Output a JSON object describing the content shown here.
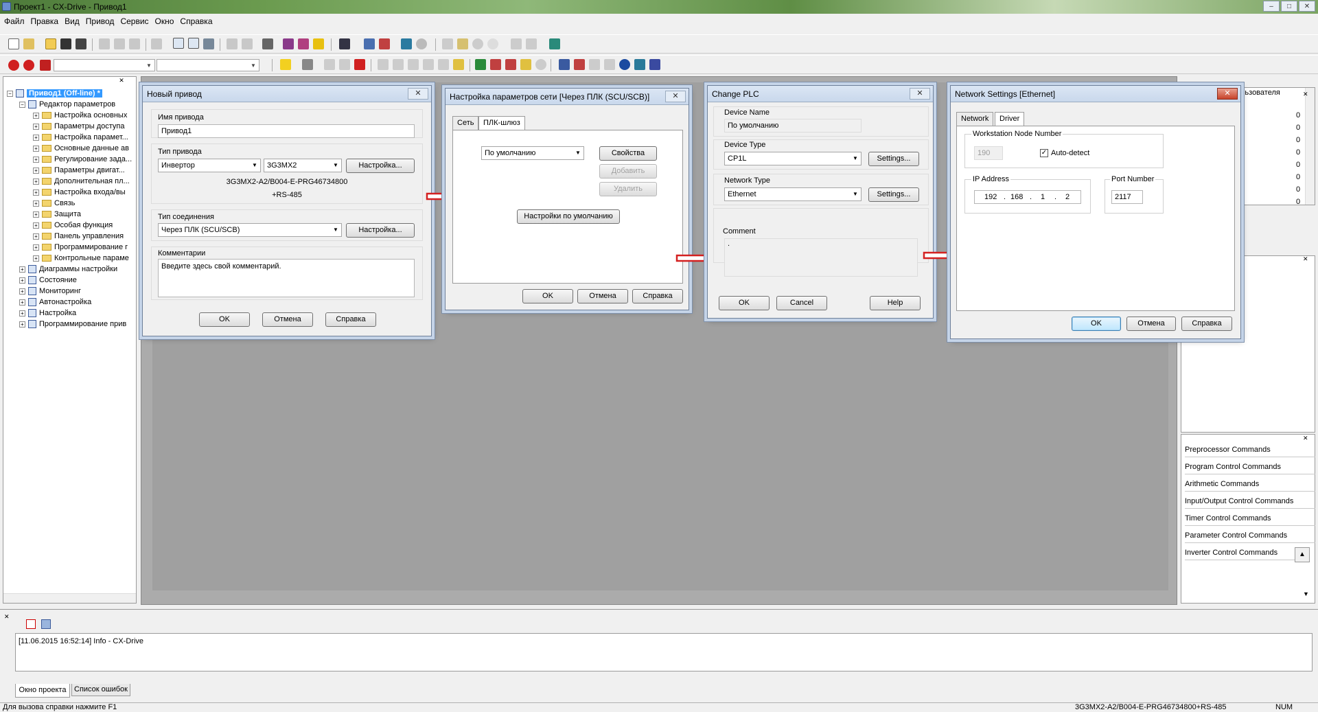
{
  "window": {
    "title": "Проект1 - CX-Drive - Привод1"
  },
  "menu": [
    "Файл",
    "Правка",
    "Вид",
    "Привод",
    "Сервис",
    "Окно",
    "Справка"
  ],
  "tree": {
    "root": "Привод1 (Off-line) *",
    "items": [
      {
        "label": "Редактор параметров",
        "level": 1,
        "icon": "doc"
      },
      {
        "label": "Настройка основных",
        "level": 2,
        "icon": "folder"
      },
      {
        "label": "Параметры доступа",
        "level": 2,
        "icon": "folder"
      },
      {
        "label": "Настройка парамет...",
        "level": 2,
        "icon": "folder"
      },
      {
        "label": "Основные данные ав",
        "level": 2,
        "icon": "folder"
      },
      {
        "label": "Регулирование зада...",
        "level": 2,
        "icon": "folder"
      },
      {
        "label": "Параметры двигат...",
        "level": 2,
        "icon": "folder"
      },
      {
        "label": "Дополнительная пл...",
        "level": 2,
        "icon": "folder"
      },
      {
        "label": "Настройка входа/вы",
        "level": 2,
        "icon": "folder"
      },
      {
        "label": "Связь",
        "level": 2,
        "icon": "folder"
      },
      {
        "label": "Защита",
        "level": 2,
        "icon": "folder"
      },
      {
        "label": "Особая функция",
        "level": 2,
        "icon": "folder"
      },
      {
        "label": "Панель управления",
        "level": 2,
        "icon": "folder"
      },
      {
        "label": "Программирование г",
        "level": 2,
        "icon": "folder"
      },
      {
        "label": "Контрольные параме",
        "level": 2,
        "icon": "folder"
      },
      {
        "label": "Диаграммы настройки",
        "level": 1,
        "icon": "doc"
      },
      {
        "label": "Состояние",
        "level": 1,
        "icon": "doc"
      },
      {
        "label": "Мониторинг",
        "level": 1,
        "icon": "doc"
      },
      {
        "label": "Автонастройка",
        "level": 1,
        "icon": "doc"
      },
      {
        "label": "Настройка",
        "level": 1,
        "icon": "doc"
      },
      {
        "label": "Программирование прив",
        "level": 1,
        "icon": "doc"
      }
    ]
  },
  "dlg1": {
    "title": "Новый привод",
    "name_label": "Имя привода",
    "name_value": "Привод1",
    "type_label": "Тип привода",
    "type_value": "Инвертор",
    "model_value": "3G3MX2",
    "settings_btn": "Настройка...",
    "model_full": "3G3MX2-A2/B004-E-PRG46734800",
    "model_option": "+RS-485",
    "conn_label": "Тип соединения",
    "conn_value": "Через ПЛК (SCU/SCB)",
    "settings_btn2": "Настройка...",
    "comment_label": "Комментарии",
    "comment_value": "Введите здесь свой комментарий.",
    "ok": "OK",
    "cancel": "Отмена",
    "help": "Справка"
  },
  "dlg2": {
    "title": "Настройка параметров сети [Через ПЛК (SCU/SCB)]",
    "tab1": "Сеть",
    "tab2": "ПЛК-шлюз",
    "select_value": "По умолчанию",
    "props_btn": "Свойства",
    "add_btn": "Добавить",
    "del_btn": "Удалить",
    "default_btn": "Настройки по умолчанию",
    "ok": "OK",
    "cancel": "Отмена",
    "help": "Справка"
  },
  "dlg3": {
    "title": "Change PLC",
    "device_name_label": "Device Name",
    "device_name_value": "По умолчанию",
    "device_type_label": "Device Type",
    "device_type_value": "CP1L",
    "settings_btn": "Settings...",
    "network_type_label": "Network Type",
    "network_type_value": "Ethernet",
    "settings_btn2": "Settings...",
    "comment_label": "Comment",
    "comment_value": ".",
    "ok": "OK",
    "cancel": "Cancel",
    "help": "Help"
  },
  "dlg4": {
    "title": "Network Settings [Ethernet]",
    "tab1": "Network",
    "tab2": "Driver",
    "node_label": "Workstation Node Number",
    "node_value": "190",
    "autodetect_label": "Auto-detect",
    "ip_label": "IP Address",
    "ip1": "192",
    "ip2": "168",
    "ip3": "1",
    "ip4": "2",
    "dot": ".",
    "port_label": "Port Number",
    "port_value": "2117",
    "ok": "OK",
    "cancel": "Отмена",
    "help": "Справка"
  },
  "right_top": {
    "header": "льзователя",
    "values": [
      "0",
      "0",
      "0",
      "0",
      "0",
      "0",
      "0",
      "0"
    ]
  },
  "commands": [
    "Preprocessor Commands",
    "Program Control Commands",
    "Arithmetic Commands",
    "Input/Output Control Commands",
    "Timer Control Commands",
    "Parameter Control Commands",
    "Inverter Control Commands"
  ],
  "output": {
    "line": "[11.06.2015 16:52:14] Info  - CX-Drive",
    "tab1": "Окно проекта",
    "tab2": "Список ошибок"
  },
  "status": {
    "left": "Для вызова справки нажмите F1",
    "mid": "3G3MX2-A2/B004-E-PRG46734800+RS-485",
    "right": "NUM"
  }
}
